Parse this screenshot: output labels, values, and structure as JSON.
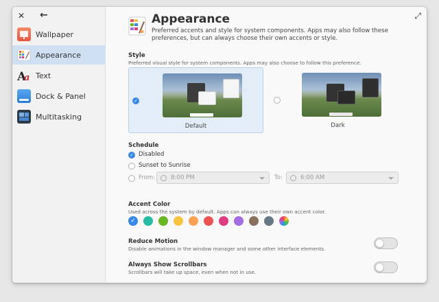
{
  "sidebar": {
    "items": [
      {
        "label": "Wallpaper",
        "icon": "wallpaper-icon",
        "color": "#e8563f"
      },
      {
        "label": "Appearance",
        "icon": "appearance-icon",
        "color": "#f0a030"
      },
      {
        "label": "Text",
        "icon": "text-icon",
        "color": "#c6262e"
      },
      {
        "label": "Dock & Panel",
        "icon": "dock-panel-icon",
        "color": "#3689e6"
      },
      {
        "label": "Multitasking",
        "icon": "multitasking-icon",
        "color": "#273445"
      }
    ],
    "active": "Appearance"
  },
  "header": {
    "title": "Appearance",
    "description": "Preferred accents and style for system components. Apps may also follow these preferences, but can always choose their own accents or style."
  },
  "style": {
    "title": "Style",
    "description": "Preferred visual style for system components. Apps may also choose to follow this preference.",
    "options": [
      {
        "label": "Default",
        "selected": true
      },
      {
        "label": "Dark",
        "selected": false
      }
    ]
  },
  "schedule": {
    "title": "Schedule",
    "options": [
      {
        "label": "Disabled",
        "selected": true
      },
      {
        "label": "Sunset to Sunrise",
        "selected": false
      }
    ],
    "manual": {
      "from_label": "From:",
      "from_value": "8:00 PM",
      "to_label": "To:",
      "to_value": "6:00 AM"
    }
  },
  "accent": {
    "title": "Accent Color",
    "description": "Used across the system by default. Apps can always use their own accent color.",
    "selected": "blueberry",
    "colors": [
      "#3689e6",
      "#28bca3",
      "#68b723",
      "#f9c440",
      "#ffa154",
      "#ed5353",
      "#de3e80",
      "#a56de2",
      "#8a715e",
      "#667885"
    ]
  },
  "reduce_motion": {
    "title": "Reduce Motion",
    "description": "Disable animations in the window manager and some other interface elements.",
    "enabled": false
  },
  "scrollbars": {
    "title": "Always Show Scrollbars",
    "description": "Scrollbars will take up space, even when not in use.",
    "enabled": false
  }
}
